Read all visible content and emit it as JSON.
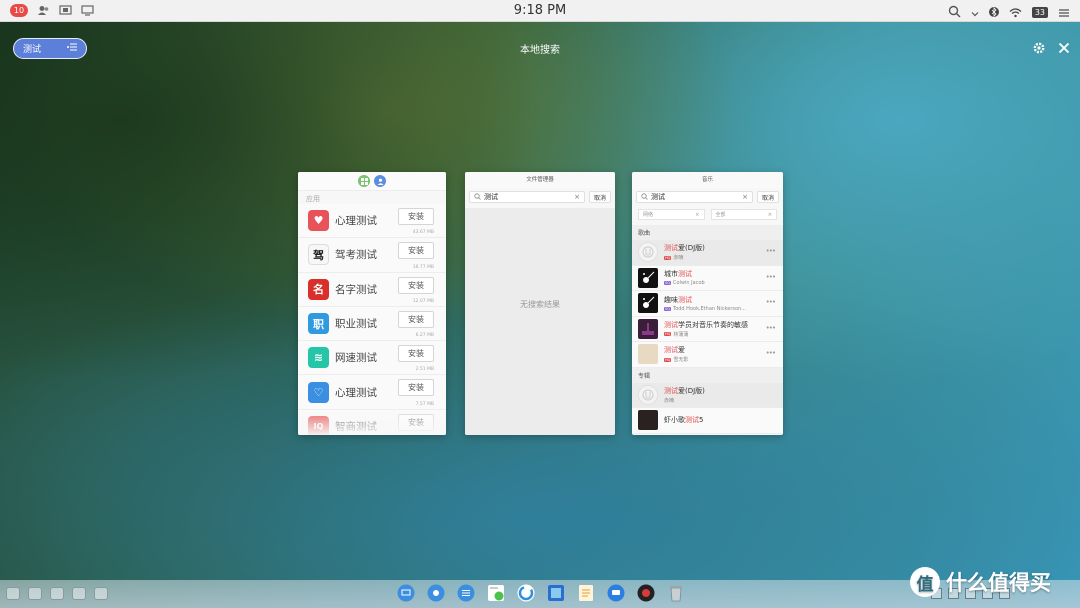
{
  "status_bar": {
    "notification_count": "10",
    "time": "9:18 PM",
    "battery": "33"
  },
  "top": {
    "search_pill_text": "测试",
    "title": "本地搜索"
  },
  "apps_card": {
    "section_label": "应用",
    "install_label": "安装",
    "items": [
      {
        "name": "心理测试",
        "size": "43.67 MB",
        "icon": "heart-icon",
        "color": "#e8525b",
        "glyph": "♥"
      },
      {
        "name": "驾考测试",
        "size": "36.77 MB",
        "icon": "driving-icon",
        "color": "#f7f7f7",
        "glyph": "驾"
      },
      {
        "name": "名字测试",
        "size": "12.07 MB",
        "icon": "name-icon",
        "color": "#d9302b",
        "glyph": "名"
      },
      {
        "name": "职业测试",
        "size": "6.27 MB",
        "icon": "career-icon",
        "color": "#2f9ae0",
        "glyph": "职"
      },
      {
        "name": "网速测试",
        "size": "2.51 MB",
        "icon": "wifi-icon",
        "color": "#25c6a8",
        "glyph": "≋"
      },
      {
        "name": "心理测试",
        "size": "7.57 MB",
        "icon": "heart-icon",
        "color": "#3a8fe0",
        "glyph": "♡"
      },
      {
        "name": "智商测试",
        "size": "",
        "icon": "iq-icon",
        "color": "#e84c4c",
        "glyph": "IQ"
      }
    ]
  },
  "files_card": {
    "title": "文件管理器",
    "search_value": "测试",
    "cancel": "取消",
    "empty_text": "无搜索结果"
  },
  "music_card": {
    "title": "音乐",
    "search_value": "测试",
    "cancel": "取消",
    "filter_source": "网络",
    "filter_type": "全部",
    "songs_label": "歌曲",
    "albums_label": "专辑",
    "songs": [
      {
        "pre": "",
        "hl": "测试",
        "post": "爱(DJ版)",
        "artist": "赤喃",
        "tag": "HQ",
        "thumb": "placeholder"
      },
      {
        "pre": "城市",
        "hl": "测试",
        "post": "",
        "artist": "Colwin Jacob",
        "tag": "SQ",
        "thumb": "guitar"
      },
      {
        "pre": "趣味",
        "hl": "测试",
        "post": "",
        "artist": "Todd Hook,Ethan Nickerson...",
        "tag": "SQ",
        "thumb": "guitar"
      },
      {
        "pre": "",
        "hl": "测试",
        "post": "学员对音乐节奏的敏感",
        "artist": "林蒲蒲",
        "tag": "HQ",
        "thumb": "concert"
      },
      {
        "pre": "",
        "hl": "测试",
        "post": "爱",
        "artist": "雪无影",
        "tag": "HQ",
        "thumb": "beige"
      }
    ],
    "albums": [
      {
        "pre": "",
        "hl": "测试",
        "post": "爱(DJ版)",
        "artist": "赤喃",
        "thumb": "placeholder"
      },
      {
        "pre": "虾小歌",
        "hl": "测试",
        "post": "5",
        "artist": "",
        "thumb": "dark"
      }
    ]
  },
  "watermark": {
    "logo_glyph": "值",
    "text": "什么值得买"
  }
}
